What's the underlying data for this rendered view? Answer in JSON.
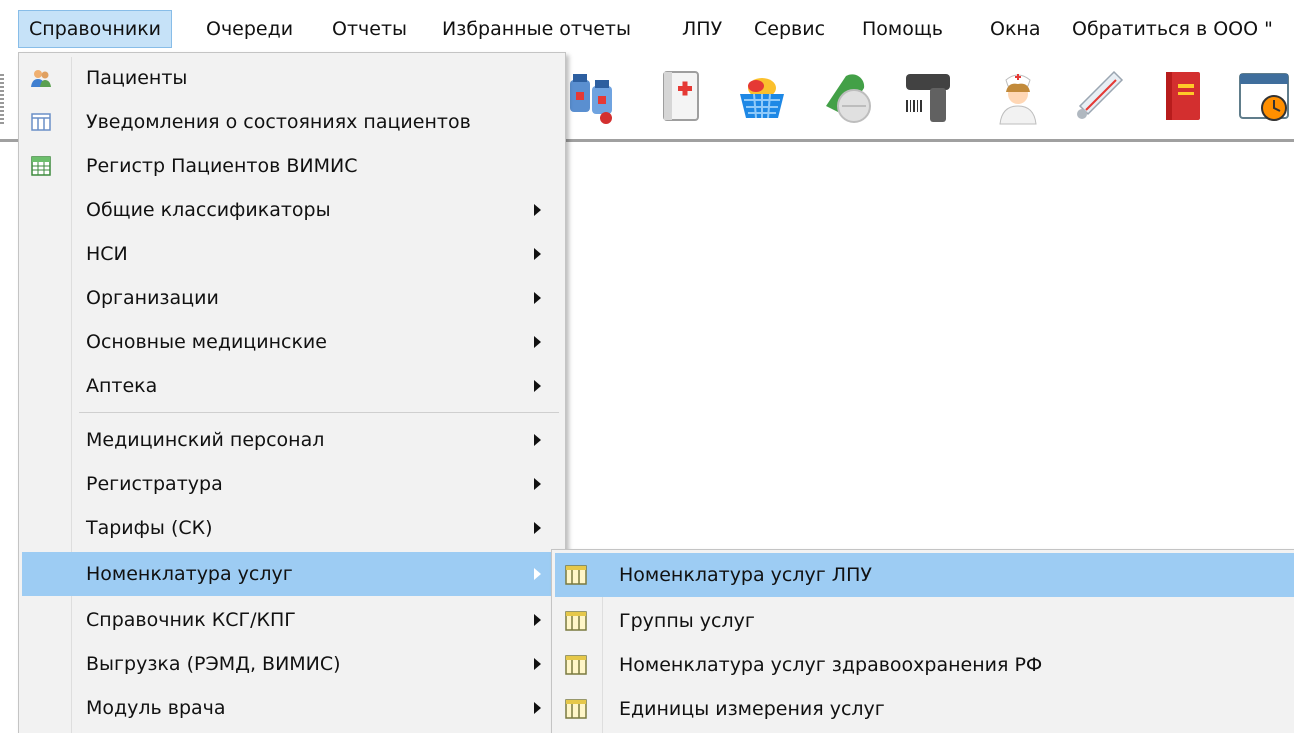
{
  "menubar": {
    "items": [
      {
        "label": "Справочники",
        "active": true
      },
      {
        "label": "Очереди"
      },
      {
        "label": "Отчеты"
      },
      {
        "label": "Избранные отчеты"
      },
      {
        "label": "ЛПУ"
      },
      {
        "label": "Сервис"
      },
      {
        "label": "Помощь"
      },
      {
        "label": "Окна"
      },
      {
        "label": "Обратиться в ООО \""
      }
    ]
  },
  "toolbar": {
    "icons": [
      "medicine-bottles-icon",
      "first-aid-book-icon",
      "pills-basket-icon",
      "pill-capsule-icon",
      "barcode-scanner-icon",
      "nurse-icon",
      "thermometer-icon",
      "red-book-icon",
      "calendar-clock-icon"
    ]
  },
  "menu": {
    "items": [
      {
        "label": "Пациенты",
        "icon": "patients-icon",
        "submenu": false
      },
      {
        "label": "Уведомления о состояниях пациентов",
        "icon": "table-grid-icon",
        "submenu": false
      },
      {
        "label": "Регистр Пациентов ВИМИС",
        "icon": "spreadsheet-icon",
        "submenu": false
      },
      {
        "label": "Общие классификаторы",
        "submenu": true
      },
      {
        "label": "НСИ",
        "submenu": true
      },
      {
        "label": "Организации",
        "submenu": true
      },
      {
        "label": "Основные медицинские",
        "submenu": true
      },
      {
        "label": "Аптека",
        "submenu": true
      },
      {
        "label": "Медицинский персонал",
        "submenu": true
      },
      {
        "label": "Регистратура",
        "submenu": true
      },
      {
        "label": "Тарифы (СК)",
        "submenu": true
      },
      {
        "label": "Номенклатура услуг",
        "submenu": true,
        "highlighted": true
      },
      {
        "label": "Справочник КСГ/КПГ",
        "submenu": true
      },
      {
        "label": "Выгрузка (РЭМД, ВИМИС)",
        "submenu": true
      },
      {
        "label": "Модуль врача",
        "submenu": true
      }
    ]
  },
  "submenu": {
    "items": [
      {
        "label": "Номенклатура услуг ЛПУ",
        "icon": "table-grid-icon",
        "highlighted": true
      },
      {
        "label": "Группы услуг",
        "icon": "table-grid-icon"
      },
      {
        "label": "Номенклатура услуг здравоохранения РФ",
        "icon": "table-grid-icon"
      },
      {
        "label": "Единицы измерения услуг",
        "icon": "table-grid-icon"
      }
    ]
  },
  "colors": {
    "highlight": "#9dccf3",
    "menubar_active": "#c6e2f8",
    "menu_background": "#f2f2f2"
  }
}
